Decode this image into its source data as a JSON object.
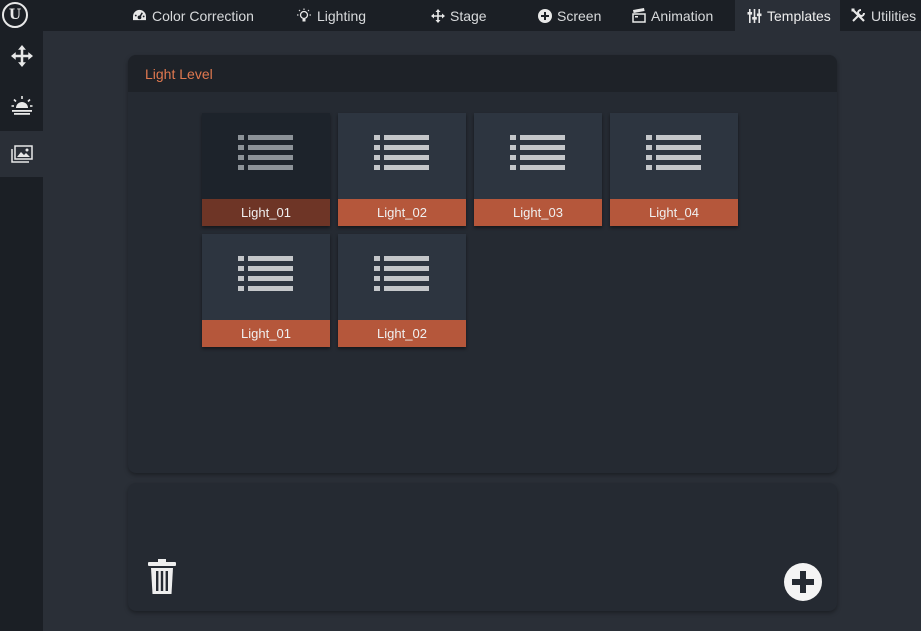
{
  "topbar": {
    "tabs": [
      {
        "label": "Color Correction",
        "icon": "dashboard-icon"
      },
      {
        "label": "Lighting",
        "icon": "lightbulb-icon"
      },
      {
        "label": "Stage",
        "icon": "move-icon"
      },
      {
        "label": "Screen",
        "icon": "plus-circle-icon"
      },
      {
        "label": "Animation",
        "icon": "clapperboard-icon"
      },
      {
        "label": "Templates",
        "icon": "sliders-icon"
      },
      {
        "label": "Utilities",
        "icon": "tools-icon"
      }
    ],
    "active_tab": "Templates",
    "logo": "U"
  },
  "sidebar": {
    "items": [
      {
        "name": "move",
        "icon": "move-arrows-icon"
      },
      {
        "name": "sunrise",
        "icon": "sunrise-icon"
      },
      {
        "name": "images",
        "icon": "images-icon"
      }
    ],
    "active_item": "images"
  },
  "panel": {
    "title": "Light Level",
    "templates": [
      {
        "label": "Light_01",
        "selected": true
      },
      {
        "label": "Light_02",
        "selected": false
      },
      {
        "label": "Light_03",
        "selected": false
      },
      {
        "label": "Light_04",
        "selected": false
      },
      {
        "label": "Light_01",
        "selected": false
      },
      {
        "label": "Light_02",
        "selected": false
      }
    ]
  },
  "colors": {
    "accent": "#b5573b",
    "accent_selected": "#6e3526",
    "title": "#e0784f",
    "background": "#2a2f37",
    "bar": "#1b1f25"
  }
}
